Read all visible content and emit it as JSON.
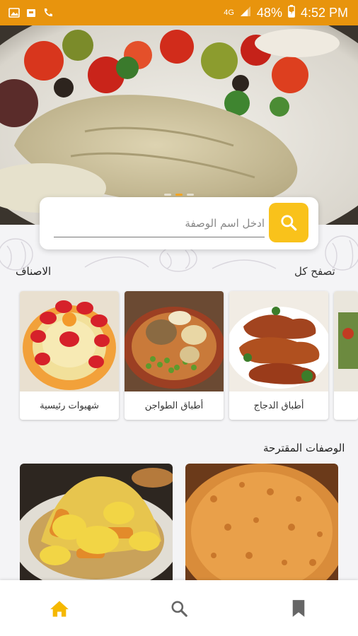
{
  "status_bar": {
    "network": "4G",
    "battery": "48%",
    "time": "4:52 PM"
  },
  "hero": {
    "slides": 3,
    "active_slide": 1
  },
  "search": {
    "placeholder": "ادخل اسم الوصفة"
  },
  "categories": {
    "title": "الاصناف",
    "browse_all": "تصفح كل",
    "items": [
      {
        "label": "شهيوات رئيسية"
      },
      {
        "label": "أطباق الطواجن"
      },
      {
        "label": "أطباق الدجاج"
      }
    ]
  },
  "suggested": {
    "title": "الوصفات المقترحة"
  },
  "colors": {
    "accent": "#e8940d",
    "search_button": "#f9c21b",
    "nav_active": "#f5b800",
    "nav_inactive": "#666666"
  },
  "bottom_nav": {
    "items": [
      {
        "icon": "home-icon",
        "active": true
      },
      {
        "icon": "search-icon",
        "active": false
      },
      {
        "icon": "bookmark-icon",
        "active": false
      }
    ]
  }
}
